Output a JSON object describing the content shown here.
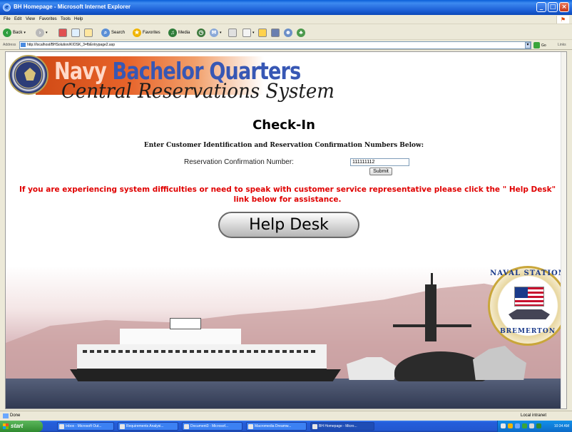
{
  "window": {
    "title": "BH Homepage - Microsoft Internet Explorer",
    "minimize_label": "_",
    "maximize_label": "□",
    "close_label": "×"
  },
  "menu": [
    "File",
    "Edit",
    "View",
    "Favorites",
    "Tools",
    "Help"
  ],
  "toolbar": {
    "back_label": "Back",
    "search_label": "Search",
    "favorites_label": "Favorites",
    "media_label": "Media"
  },
  "address": {
    "label": "Address",
    "url": "http://localhost/BHSolution/KIOSK_3=fbEntrypage2.asp",
    "go_label": "Go",
    "links_label": "Links"
  },
  "page": {
    "brand_line1_a": "Navy",
    "brand_line1_b": "Bachelor Quarters",
    "brand_line2": "Central Reservations System",
    "heading": "Check-In",
    "instructions": "Enter Customer Identification and Reservation Confirmation Numbers Below:",
    "reservation_label": "Reservation Confirmation Number:",
    "reservation_value": "111111112",
    "submit_label": "Submit",
    "warning": "If you are experiencing system difficulties or need to speak with customer service representative please click the \" Help Desk\" link below for assistance.",
    "help_desk_label": "Help Desk",
    "seal_top_text": "NAVAL STATION",
    "seal_bottom_text": "BREMERTON"
  },
  "status": {
    "text": "Done",
    "zone": "Local intranet"
  },
  "taskbar": {
    "start_label": "start",
    "tasks": [
      "Inbox - Microsoft Out...",
      "Requirements Analysi...",
      "Document3 - Microsof...",
      "Macromedia Dreamw...",
      "BH Homepage - Micro..."
    ],
    "clock": "10:34 AM"
  }
}
